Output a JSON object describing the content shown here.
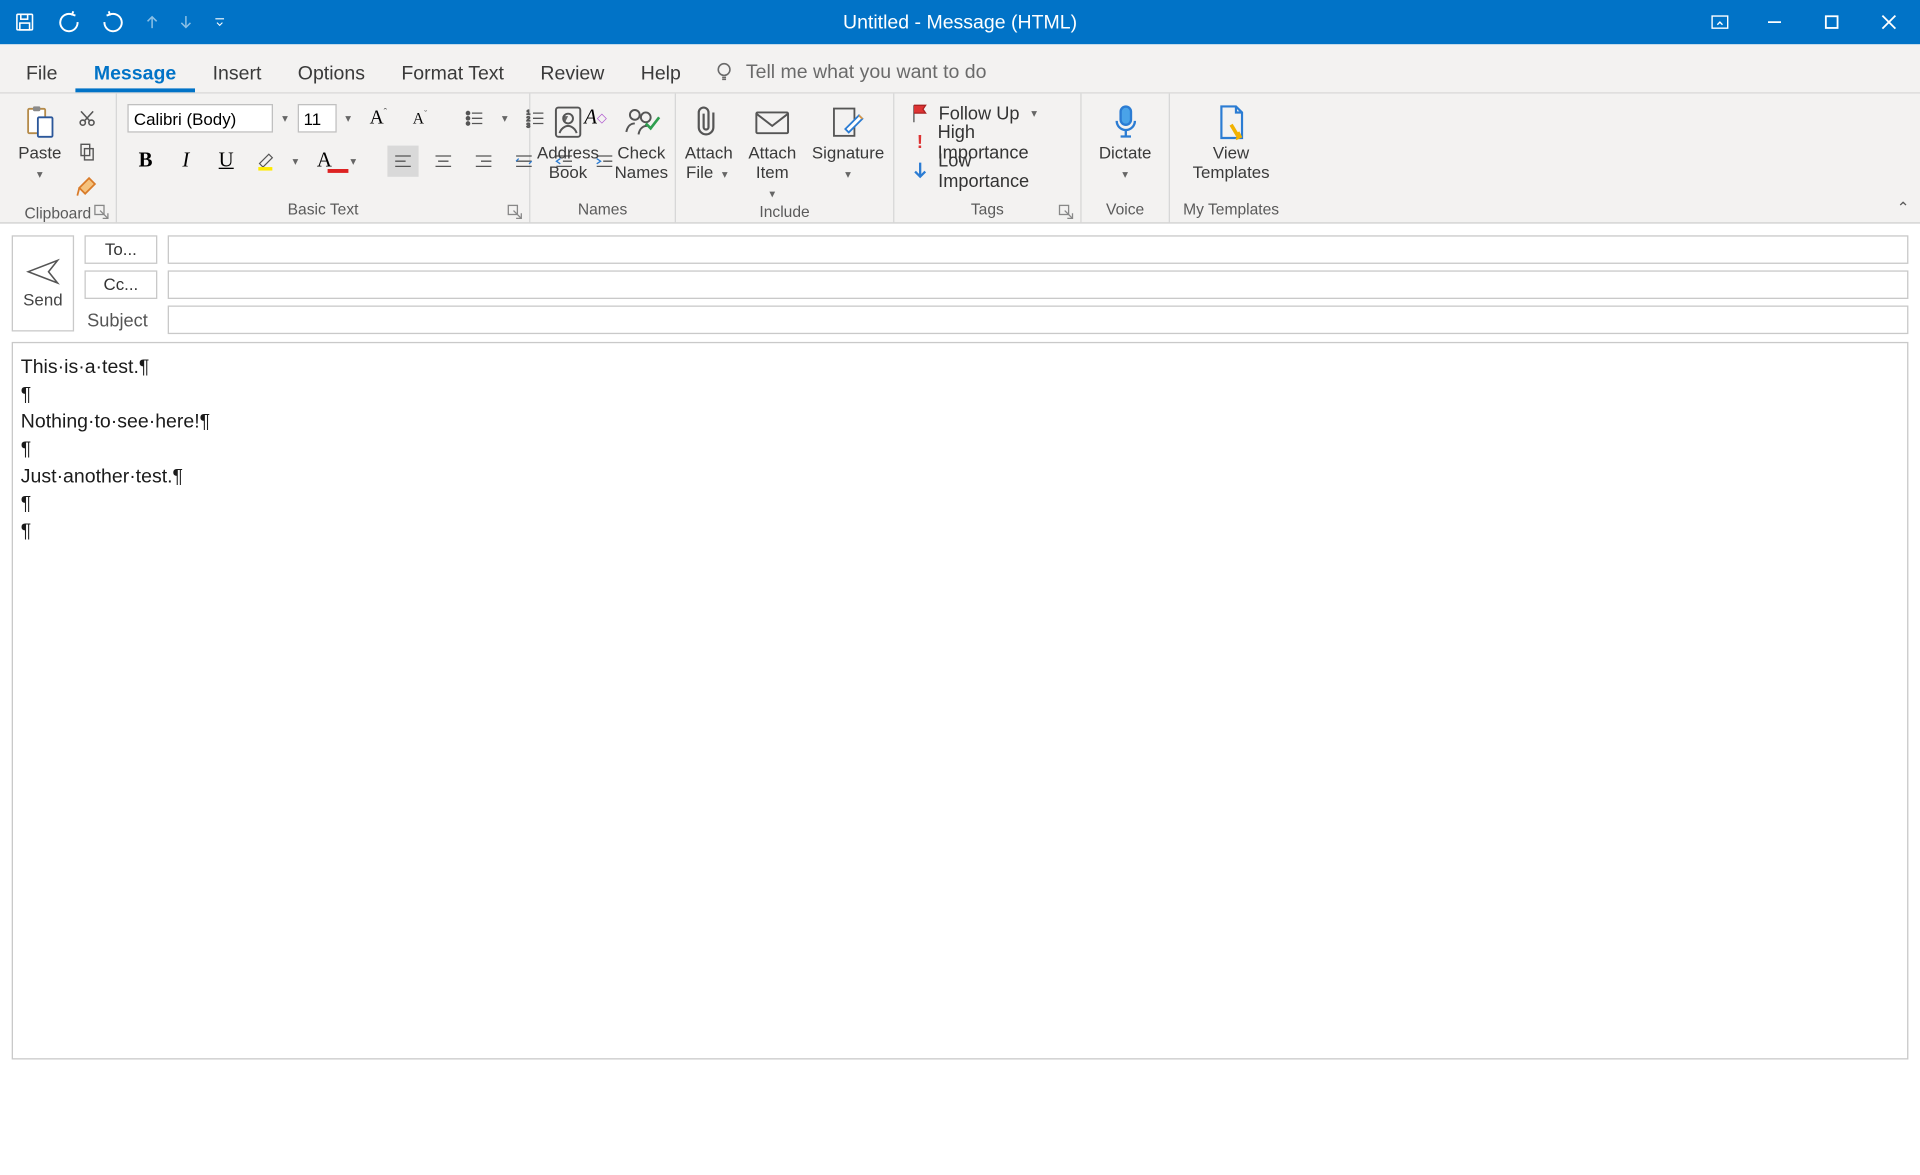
{
  "window": {
    "title": "Untitled  -  Message (HTML)"
  },
  "tabs": {
    "file": "File",
    "message": "Message",
    "insert": "Insert",
    "options": "Options",
    "format": "Format Text",
    "review": "Review",
    "help": "Help",
    "tellme": "Tell me what you want to do"
  },
  "ribbon": {
    "clipboard": {
      "paste": "Paste",
      "label": "Clipboard"
    },
    "basictext": {
      "label": "Basic Text",
      "font_name": "Calibri (Body)",
      "font_size": "11"
    },
    "names": {
      "label": "Names",
      "address": "Address Book",
      "check": "Check Names"
    },
    "include": {
      "label": "Include",
      "attachfile": "Attach File",
      "attachitem": "Attach Item",
      "signature": "Signature"
    },
    "tags": {
      "label": "Tags",
      "follow": "Follow Up",
      "high": "High Importance",
      "low": "Low Importance"
    },
    "voice": {
      "label": "Voice",
      "dictate": "Dictate"
    },
    "templates": {
      "label": "My Templates",
      "view": "View Templates"
    }
  },
  "fields": {
    "send": "Send",
    "to": "To...",
    "cc": "Cc...",
    "subject": "Subject",
    "to_val": "",
    "cc_val": "",
    "subject_val": ""
  },
  "body": {
    "l1": "This·is·a·test.¶",
    "l2": "¶",
    "l3": "Nothing·to·see·here!¶",
    "l4": "¶",
    "l5": "Just·another·test.¶",
    "l6": "¶",
    "l7": "¶"
  }
}
